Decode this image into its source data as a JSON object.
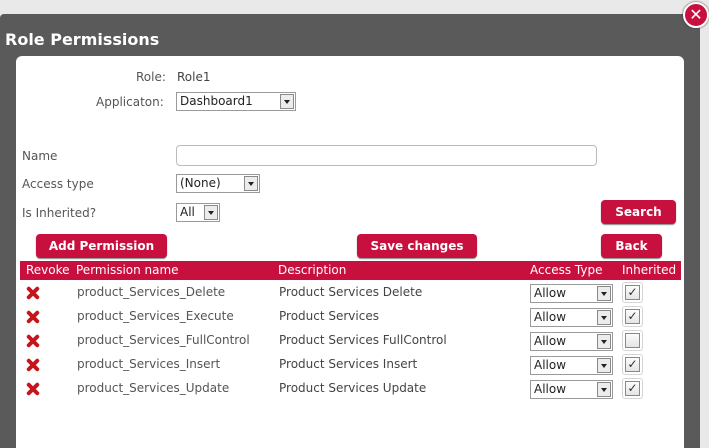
{
  "dialog": {
    "title": "Role Permissions",
    "close_label": "✕"
  },
  "form": {
    "role_label": "Role:",
    "role_value": "Role1",
    "application_label": "Applicaton:",
    "application_value": "Dashboard1",
    "name_label": "Name",
    "name_value": "",
    "access_type_label": "Access type",
    "access_type_value": "(None)",
    "is_inherited_label": "Is Inherited?",
    "is_inherited_value": "All"
  },
  "buttons": {
    "search": "Search",
    "add_permission": "Add Permission",
    "save_changes": "Save changes",
    "back": "Back"
  },
  "table": {
    "headers": [
      "Revoke",
      "Permission name",
      "Description",
      "Access Type",
      "Inherited"
    ],
    "rows": [
      {
        "name": "product_Services_Delete",
        "description": "Product Services Delete",
        "access": "Allow",
        "inherited": true
      },
      {
        "name": "product_Services_Execute",
        "description": "Product Services",
        "access": "Allow",
        "inherited": true
      },
      {
        "name": "product_Services_FullControl",
        "description": "Product Services FullControl",
        "access": "Allow",
        "inherited": false
      },
      {
        "name": "product_Services_Insert",
        "description": "Product Services Insert",
        "access": "Allow",
        "inherited": true
      },
      {
        "name": "product_Services_Update",
        "description": "Product Services Update",
        "access": "Allow",
        "inherited": true
      }
    ]
  },
  "icons": {
    "revoke": "delete-x-icon",
    "close": "close-icon",
    "dropdown": "chevron-down-icon"
  },
  "colors": {
    "accent": "#c8103f",
    "dialog_bg": "#5a5a5a",
    "revoke_icon": "#c4161c"
  }
}
